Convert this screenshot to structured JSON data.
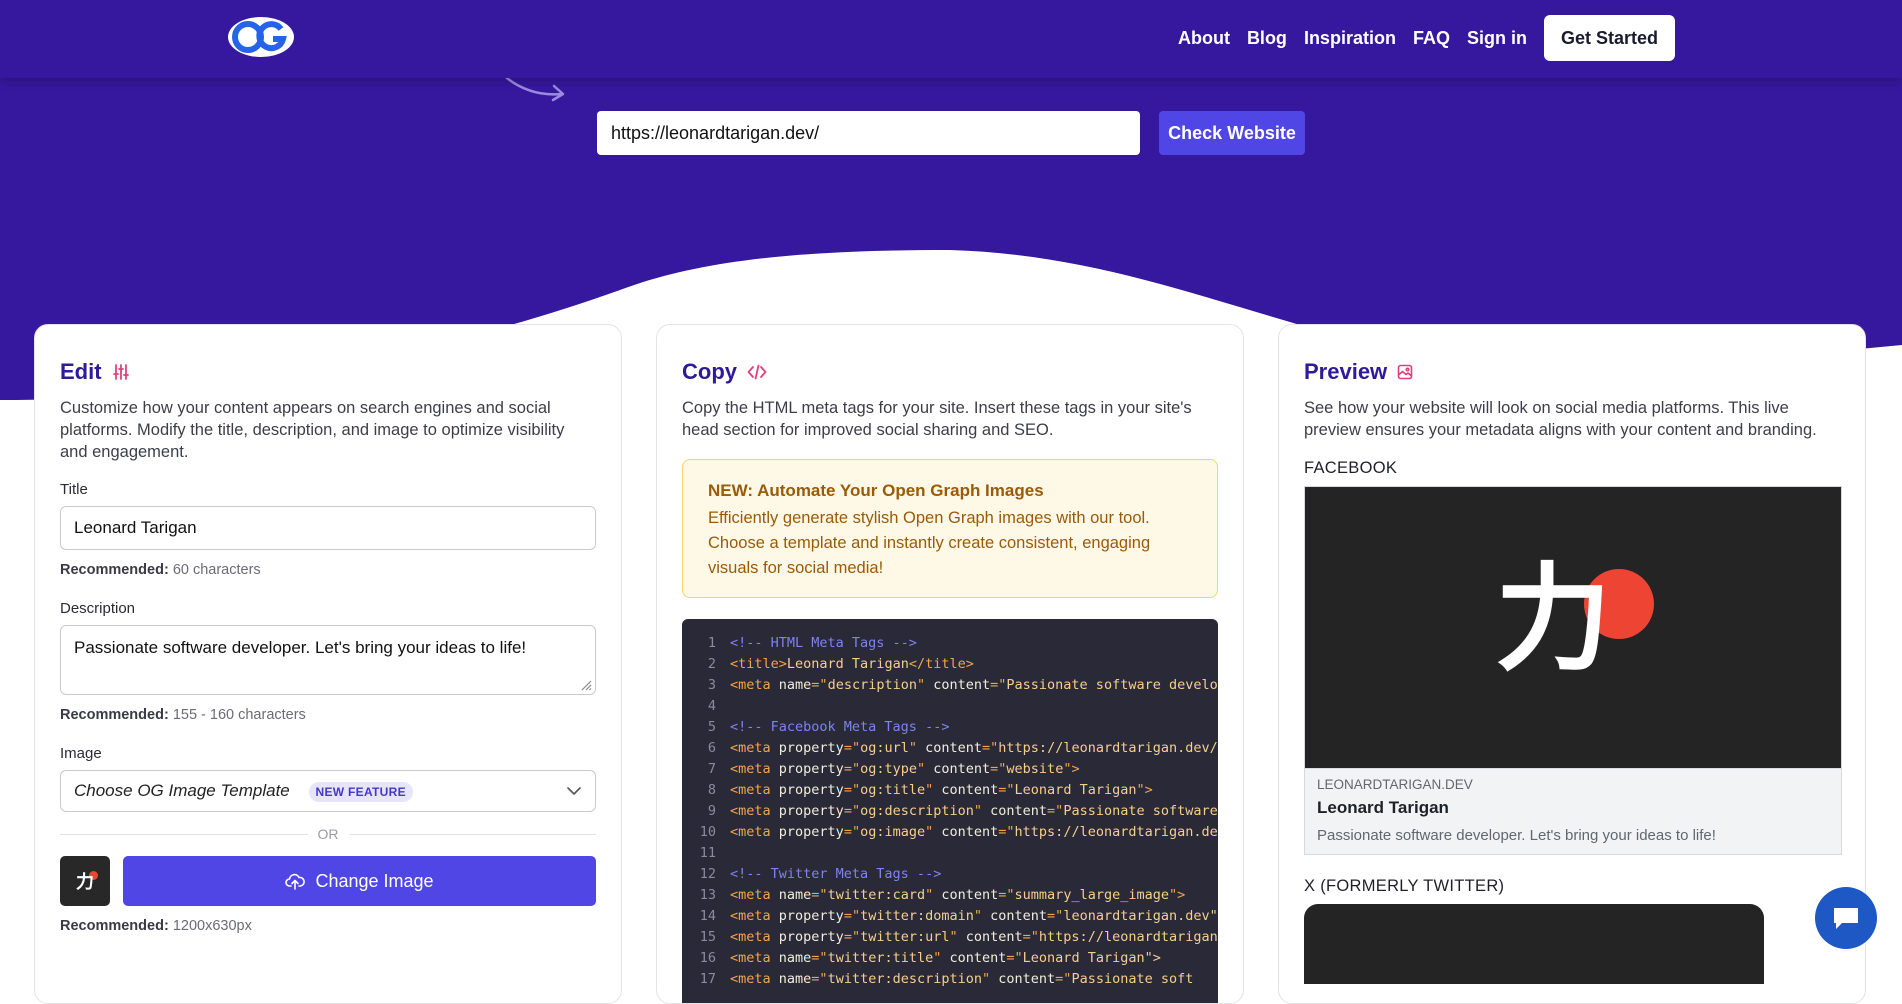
{
  "nav": {
    "links": [
      "About",
      "Blog",
      "Inspiration",
      "FAQ",
      "Sign in"
    ],
    "cta": "Get Started"
  },
  "hero": {
    "url_value": "https://leonardtarigan.dev/",
    "check_button": "Check Website"
  },
  "edit": {
    "title": "Edit",
    "description": "Customize how your content appears on search engines and social platforms. Modify the title, description, and image to optimize visibility and engagement.",
    "title_label": "Title",
    "title_value": "Leonard Tarigan",
    "title_hint_label": "Recommended:",
    "title_hint_value": "60 characters",
    "desc_label": "Description",
    "desc_value": "Passionate software developer. Let's bring your ideas to life!",
    "desc_hint_label": "Recommended:",
    "desc_hint_value": "155 - 160 characters",
    "image_label": "Image",
    "image_select": "Choose OG Image Template",
    "image_badge": "NEW FEATURE",
    "or": "OR",
    "change_image": "Change Image",
    "image_hint_label": "Recommended:",
    "image_hint_value": "1200x630px",
    "thumb_glyph": "力"
  },
  "copy": {
    "title": "Copy",
    "description": "Copy the HTML meta tags for your site. Insert these tags in your site's head section for improved social sharing and SEO.",
    "promo_title": "NEW: Automate Your Open Graph Images",
    "promo_body": "Efficiently generate stylish Open Graph images with our tool. Choose a template and instantly create consistent, engaging visuals for social media!",
    "code_lines": [
      [
        {
          "t": "c",
          "v": "<!-- HTML Meta Tags -->"
        }
      ],
      [
        {
          "t": "g",
          "v": "<title>"
        },
        {
          "t": "s",
          "v": "Leonard Tarigan"
        },
        {
          "t": "g",
          "v": "</title>"
        }
      ],
      [
        {
          "t": "g",
          "v": "<meta "
        },
        {
          "t": "a",
          "v": "name"
        },
        {
          "t": "g",
          "v": "=\""
        },
        {
          "t": "s",
          "v": "description"
        },
        {
          "t": "g",
          "v": "\" "
        },
        {
          "t": "a",
          "v": "content"
        },
        {
          "t": "g",
          "v": "=\""
        },
        {
          "t": "s",
          "v": "Passionate software develo"
        }
      ],
      [],
      [
        {
          "t": "c",
          "v": "<!-- Facebook Meta Tags -->"
        }
      ],
      [
        {
          "t": "g",
          "v": "<meta "
        },
        {
          "t": "a",
          "v": "property"
        },
        {
          "t": "g",
          "v": "=\""
        },
        {
          "t": "s",
          "v": "og:url"
        },
        {
          "t": "g",
          "v": "\" "
        },
        {
          "t": "a",
          "v": "content"
        },
        {
          "t": "g",
          "v": "=\""
        },
        {
          "t": "s",
          "v": "https://leonardtarigan.dev/"
        }
      ],
      [
        {
          "t": "g",
          "v": "<meta "
        },
        {
          "t": "a",
          "v": "property"
        },
        {
          "t": "g",
          "v": "=\""
        },
        {
          "t": "s",
          "v": "og:type"
        },
        {
          "t": "g",
          "v": "\" "
        },
        {
          "t": "a",
          "v": "content"
        },
        {
          "t": "g",
          "v": "=\""
        },
        {
          "t": "s",
          "v": "website"
        },
        {
          "t": "g",
          "v": "\">"
        }
      ],
      [
        {
          "t": "g",
          "v": "<meta "
        },
        {
          "t": "a",
          "v": "property"
        },
        {
          "t": "g",
          "v": "=\""
        },
        {
          "t": "s",
          "v": "og:title"
        },
        {
          "t": "g",
          "v": "\" "
        },
        {
          "t": "a",
          "v": "content"
        },
        {
          "t": "g",
          "v": "=\""
        },
        {
          "t": "s",
          "v": "Leonard Tarigan"
        },
        {
          "t": "g",
          "v": "\">"
        }
      ],
      [
        {
          "t": "g",
          "v": "<meta "
        },
        {
          "t": "a",
          "v": "property"
        },
        {
          "t": "g",
          "v": "=\""
        },
        {
          "t": "s",
          "v": "og:description"
        },
        {
          "t": "g",
          "v": "\" "
        },
        {
          "t": "a",
          "v": "content"
        },
        {
          "t": "g",
          "v": "=\""
        },
        {
          "t": "s",
          "v": "Passionate software"
        }
      ],
      [
        {
          "t": "g",
          "v": "<meta "
        },
        {
          "t": "a",
          "v": "property"
        },
        {
          "t": "g",
          "v": "=\""
        },
        {
          "t": "s",
          "v": "og:image"
        },
        {
          "t": "g",
          "v": "\" "
        },
        {
          "t": "a",
          "v": "content"
        },
        {
          "t": "g",
          "v": "=\""
        },
        {
          "t": "s",
          "v": "https://leonardtarigan.de"
        }
      ],
      [],
      [
        {
          "t": "c",
          "v": "<!-- Twitter Meta Tags -->"
        }
      ],
      [
        {
          "t": "g",
          "v": "<meta "
        },
        {
          "t": "a",
          "v": "name"
        },
        {
          "t": "g",
          "v": "=\""
        },
        {
          "t": "s",
          "v": "twitter:card"
        },
        {
          "t": "g",
          "v": "\" "
        },
        {
          "t": "a",
          "v": "content"
        },
        {
          "t": "g",
          "v": "=\""
        },
        {
          "t": "s",
          "v": "summary_large_image"
        },
        {
          "t": "g",
          "v": "\">"
        }
      ],
      [
        {
          "t": "g",
          "v": "<meta "
        },
        {
          "t": "a",
          "v": "property"
        },
        {
          "t": "g",
          "v": "=\""
        },
        {
          "t": "s",
          "v": "twitter:domain"
        },
        {
          "t": "g",
          "v": "\" "
        },
        {
          "t": "a",
          "v": "content"
        },
        {
          "t": "g",
          "v": "=\""
        },
        {
          "t": "s",
          "v": "leonardtarigan.dev\""
        }
      ],
      [
        {
          "t": "g",
          "v": "<meta "
        },
        {
          "t": "a",
          "v": "property"
        },
        {
          "t": "g",
          "v": "=\""
        },
        {
          "t": "s",
          "v": "twitter:url"
        },
        {
          "t": "g",
          "v": "\" "
        },
        {
          "t": "a",
          "v": "content"
        },
        {
          "t": "g",
          "v": "=\""
        },
        {
          "t": "s",
          "v": "https://leonardtarigan"
        }
      ],
      [
        {
          "t": "g",
          "v": "<meta "
        },
        {
          "t": "a",
          "v": "name"
        },
        {
          "t": "g",
          "v": "=\""
        },
        {
          "t": "s",
          "v": "twitter:title"
        },
        {
          "t": "g",
          "v": "\" "
        },
        {
          "t": "a",
          "v": "content"
        },
        {
          "t": "g",
          "v": "=\""
        },
        {
          "t": "s",
          "v": "Leonard Tarigan\">"
        }
      ],
      [
        {
          "t": "g",
          "v": "<meta "
        },
        {
          "t": "a",
          "v": "name"
        },
        {
          "t": "g",
          "v": "=\""
        },
        {
          "t": "s",
          "v": "twitter:description"
        },
        {
          "t": "g",
          "v": "\" "
        },
        {
          "t": "a",
          "v": "content"
        },
        {
          "t": "g",
          "v": "=\""
        },
        {
          "t": "s",
          "v": "Passionate soft"
        }
      ]
    ]
  },
  "preview": {
    "title": "Preview",
    "description": "See how your website will look on social media platforms. This live preview ensures your metadata aligns with your content and branding.",
    "facebook_label": "FACEBOOK",
    "fb_glyph": "力",
    "fb_domain": "LEONARDTARIGAN.DEV",
    "fb_title": "Leonard Tarigan",
    "fb_desc": "Passionate software developer. Let's bring your ideas to life!",
    "x_label": "X (FORMERLY TWITTER)"
  },
  "colors": {
    "hero": "#36189f",
    "accent": "#4f46e5",
    "title": "#2e1a9a",
    "icon_accent": "#e0407a"
  },
  "icons": {
    "edit": "sliders-icon",
    "copy": "code-icon",
    "preview": "image-icon",
    "chat": "chat-icon",
    "upload": "cloud-upload-icon"
  }
}
